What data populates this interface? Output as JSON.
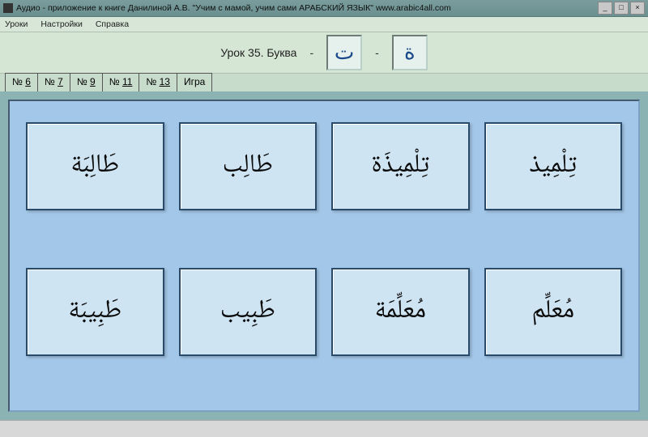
{
  "window": {
    "title": "Аудио - приложение к книге   Данилиной А.В.  \"Учим с мамой, учим сами АРАБСКИЙ ЯЗЫК\"     www.arabic4all.com"
  },
  "menu": {
    "lessons": "Уроки",
    "settings": "Настройки",
    "help": "Справка"
  },
  "lesson": {
    "label": "Урок 35.  Буква",
    "sep1": "-",
    "letter1": "ت",
    "sep2": "-",
    "letter2": "ة"
  },
  "tabs": [
    {
      "prefix": "№ ",
      "num": "6"
    },
    {
      "prefix": "№ ",
      "num": "7"
    },
    {
      "prefix": "№ ",
      "num": "9"
    },
    {
      "prefix": "№ ",
      "num": "11"
    },
    {
      "prefix": "№ ",
      "num": "13"
    },
    {
      "prefix": "",
      "num": "Игра"
    }
  ],
  "cards": [
    "طَالِبَة",
    "طَالِب",
    "تِلْمِيذَة",
    "تِلْمِيذ",
    "طَبِيبَة",
    "طَبِيب",
    "مُعَلِّمَة",
    "مُعَلِّم"
  ],
  "win_controls": {
    "min": "_",
    "max": "□",
    "close": "×"
  }
}
